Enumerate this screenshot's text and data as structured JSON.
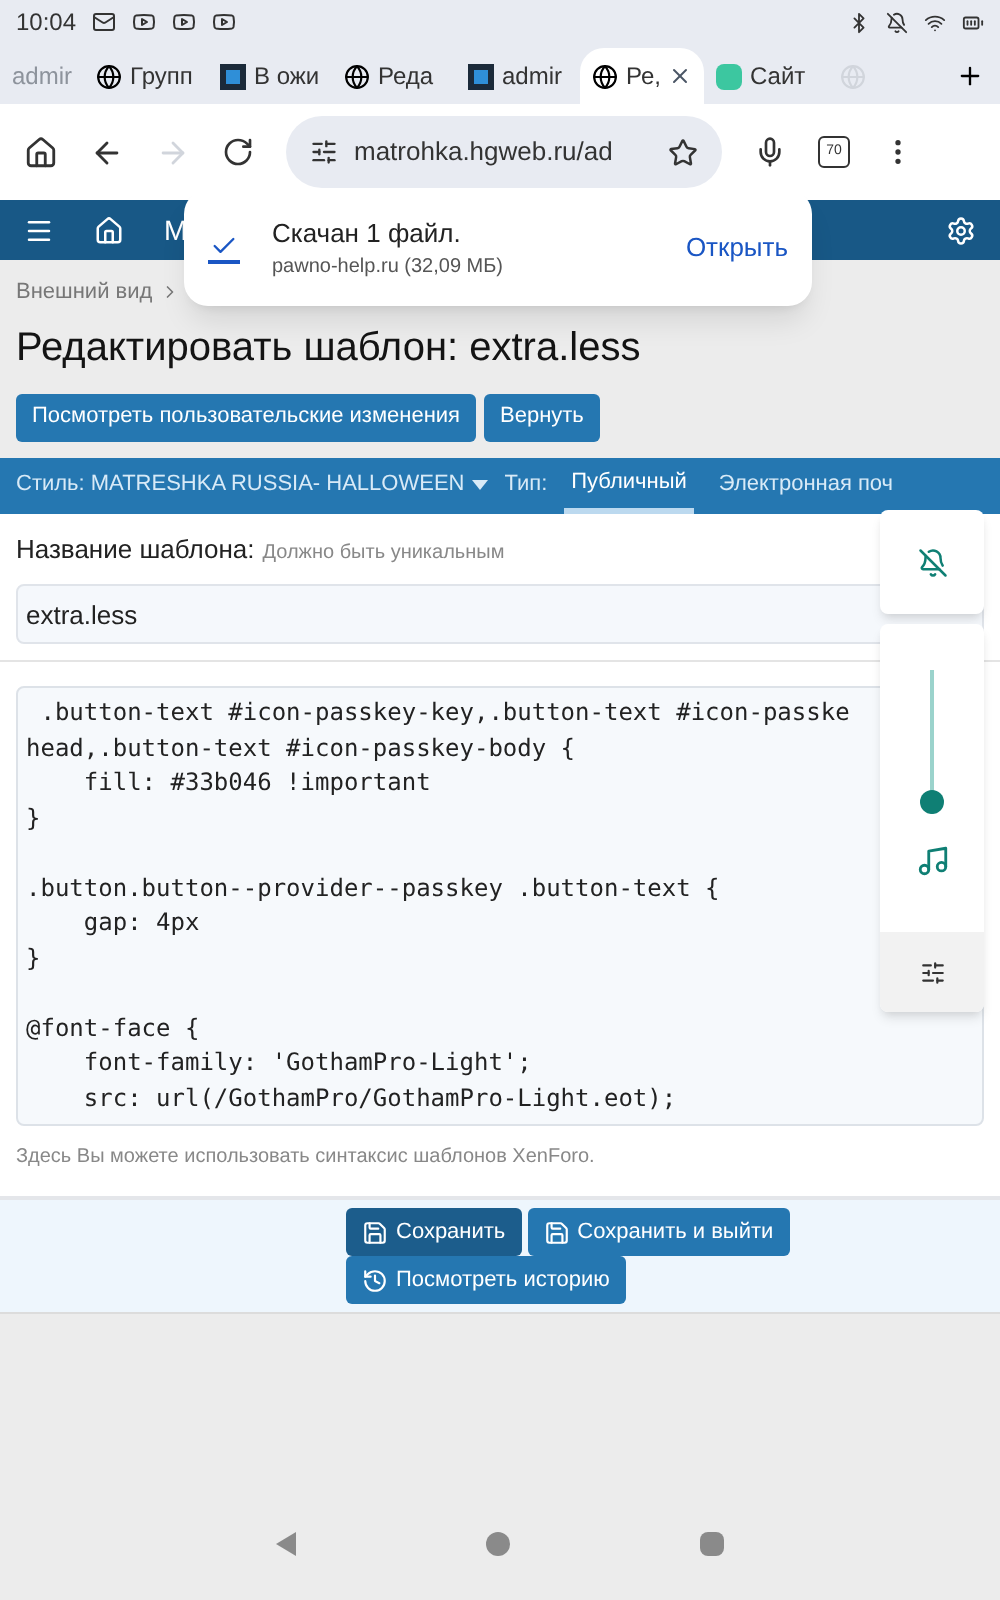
{
  "status_bar": {
    "time": "10:04"
  },
  "browser_tabs": [
    {
      "title": "admir",
      "kind": "faded",
      "selected": false
    },
    {
      "title": "Групп",
      "kind": "globe",
      "selected": false
    },
    {
      "title": "В ожи",
      "kind": "m-logo",
      "selected": false
    },
    {
      "title": "Реда",
      "kind": "globe",
      "selected": false
    },
    {
      "title": "admir",
      "kind": "m-logo",
      "selected": false
    },
    {
      "title": "Ре,",
      "kind": "globe",
      "selected": true
    },
    {
      "title": "Сайт",
      "kind": "site",
      "selected": false
    },
    {
      "kind": "ghost",
      "selected": false
    }
  ],
  "address_bar": {
    "url": "matrohka.hgweb.ru/ad",
    "tab_count": "70",
    "forward_disabled": true
  },
  "site_nav": {
    "title": "M"
  },
  "download_toast": {
    "title": "Скачан 1 файл.",
    "detail": "pawno-help.ru (32,09 МБ)",
    "action": "Открыть"
  },
  "breadcrumb": "Внешний вид",
  "page_title": "Редактировать шаблон: extra.less",
  "header_buttons": [
    "Посмотреть пользовательские изменения",
    "Вернуть"
  ],
  "style_bar": {
    "style": "Стиль: MATRESHKA RUSSIA- HALLOWEEN",
    "type_label": "Тип:",
    "tabs": [
      {
        "label": "Публичный",
        "selected": true
      },
      {
        "label": "Электронная поч",
        "selected": false
      }
    ]
  },
  "template_name": {
    "label": "Название шаблона:",
    "hint": "Должно быть уникальным",
    "value": "extra.less"
  },
  "code_blocks": [
    [
      " .button-text #icon-passkey-key,.button-text #icon-passke",
      "head,.button-text #icon-passkey-body {",
      "    fill: #33b046 !important",
      "}"
    ],
    [
      ".button.button--provider--passkey .button-text {",
      "    gap: 4px",
      "}"
    ],
    [
      "@font-face {",
      "    font-family: 'GothamPro-Light';",
      "    src: url(/GothamPro/GothamPro-Light.eot);"
    ]
  ],
  "code_hint": "Здесь Вы можете использовать синтаксис шаблонов XenForo.",
  "footer_buttons": [
    {
      "label": "Сохранить",
      "kind": "save",
      "selected": true
    },
    {
      "label": "Сохранить и выйти",
      "kind": "save",
      "selected": false
    },
    {
      "label": "Посмотреть историю",
      "kind": "history",
      "selected": false
    }
  ],
  "volume_panel": {
    "level": 0
  }
}
